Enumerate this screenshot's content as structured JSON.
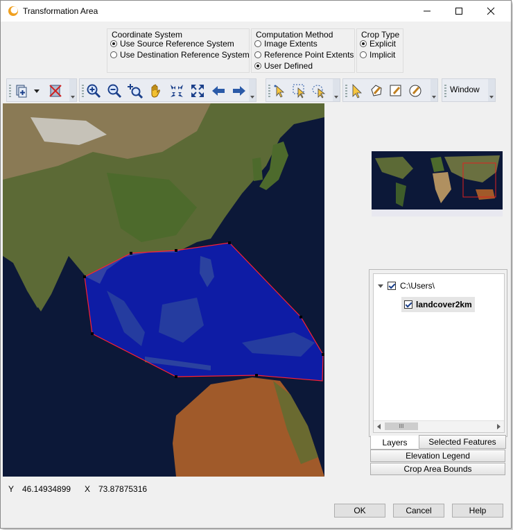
{
  "window": {
    "title": "Transformation Area"
  },
  "coordinate_system": {
    "title": "Coordinate System",
    "options": [
      {
        "label": "Use Source Reference System",
        "selected": true
      },
      {
        "label": "Use Destination Reference System",
        "selected": false
      }
    ]
  },
  "computation_method": {
    "title": "Computation Method",
    "options": [
      {
        "label": "Image Extents",
        "selected": false
      },
      {
        "label": "Reference Point Extents",
        "selected": false
      },
      {
        "label": "User Defined",
        "selected": true
      }
    ]
  },
  "crop_type": {
    "title": "Crop Type",
    "options": [
      {
        "label": "Explicit",
        "selected": true
      },
      {
        "label": "Implicit",
        "selected": false
      }
    ]
  },
  "toolbar": {
    "window_label": "Window"
  },
  "layers": {
    "root_label": "C:\\Users\\",
    "child_label": "landcover2km",
    "scroll_thumb": "III"
  },
  "tabs": {
    "layers": "Layers",
    "selected_features": "Selected Features"
  },
  "side_buttons": {
    "elevation_legend": "Elevation Legend",
    "crop_area_bounds": "Crop Area Bounds"
  },
  "status": {
    "y_label": "Y",
    "y_value": "46.14934899",
    "x_label": "X",
    "x_value": "73.87875316"
  },
  "dialog_buttons": {
    "ok": "OK",
    "cancel": "Cancel",
    "help": "Help"
  },
  "colors": {
    "crop_fill": "#1020ff",
    "crop_outline": "#ff2030",
    "ocean": "#0c1838"
  }
}
